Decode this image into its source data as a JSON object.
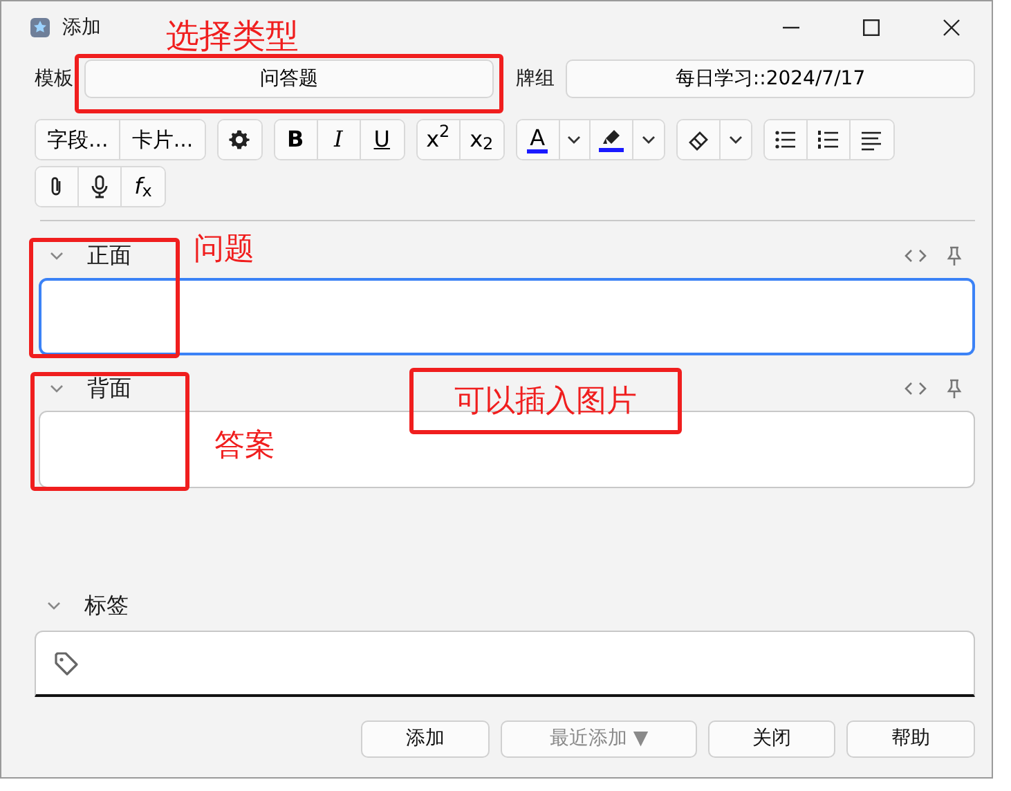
{
  "window": {
    "title": "添加"
  },
  "note_type": {
    "label": "模板",
    "value": "问答题"
  },
  "deck": {
    "label": "牌组",
    "value": "每日学习::2024/7/17"
  },
  "toolbar": [
    {
      "kind": "text",
      "label": "字段..."
    },
    {
      "kind": "text",
      "label": "卡片..."
    },
    {
      "kind": "gear"
    },
    {
      "kind": "bold",
      "label": "B"
    },
    {
      "kind": "italic",
      "label": "I"
    },
    {
      "kind": "underline",
      "label": "U"
    },
    {
      "kind": "rich",
      "label": "x$^{2}$"
    },
    {
      "kind": "rich",
      "label": "x$_{2}$"
    },
    {
      "kind": "font-color",
      "label": "A",
      "color": "#1a1aff"
    },
    {
      "kind": "caret"
    },
    {
      "kind": "highlight",
      "color": "#1a1aff"
    },
    {
      "kind": "caret"
    },
    {
      "kind": "eraser"
    },
    {
      "kind": "caret"
    },
    {
      "kind": "bullet-list"
    },
    {
      "kind": "numbered-list"
    },
    {
      "kind": "align"
    },
    {
      "kind": "paperclip"
    },
    {
      "kind": "microphone"
    },
    {
      "kind": "rich",
      "label": "*f*$_{x}$"
    }
  ],
  "fields": [
    {
      "label": "正面",
      "expanded": true,
      "focused": true
    },
    {
      "label": "背面",
      "expanded": true,
      "focused": false
    }
  ],
  "tags": {
    "label": "标签",
    "expanded": true
  },
  "buttons": [
    {
      "label": "添加",
      "disabled": false
    },
    {
      "label": "最近添加 ▼",
      "disabled": true
    },
    {
      "label": "关闭",
      "disabled": false
    },
    {
      "label": "帮助",
      "disabled": false
    }
  ],
  "annotations": [
    {
      "kind": "label",
      "text": "选择类型"
    },
    {
      "kind": "label",
      "text": "问题"
    },
    {
      "kind": "label",
      "text": "答案"
    },
    {
      "kind": "boxed",
      "text": "可以插入图片"
    }
  ]
}
